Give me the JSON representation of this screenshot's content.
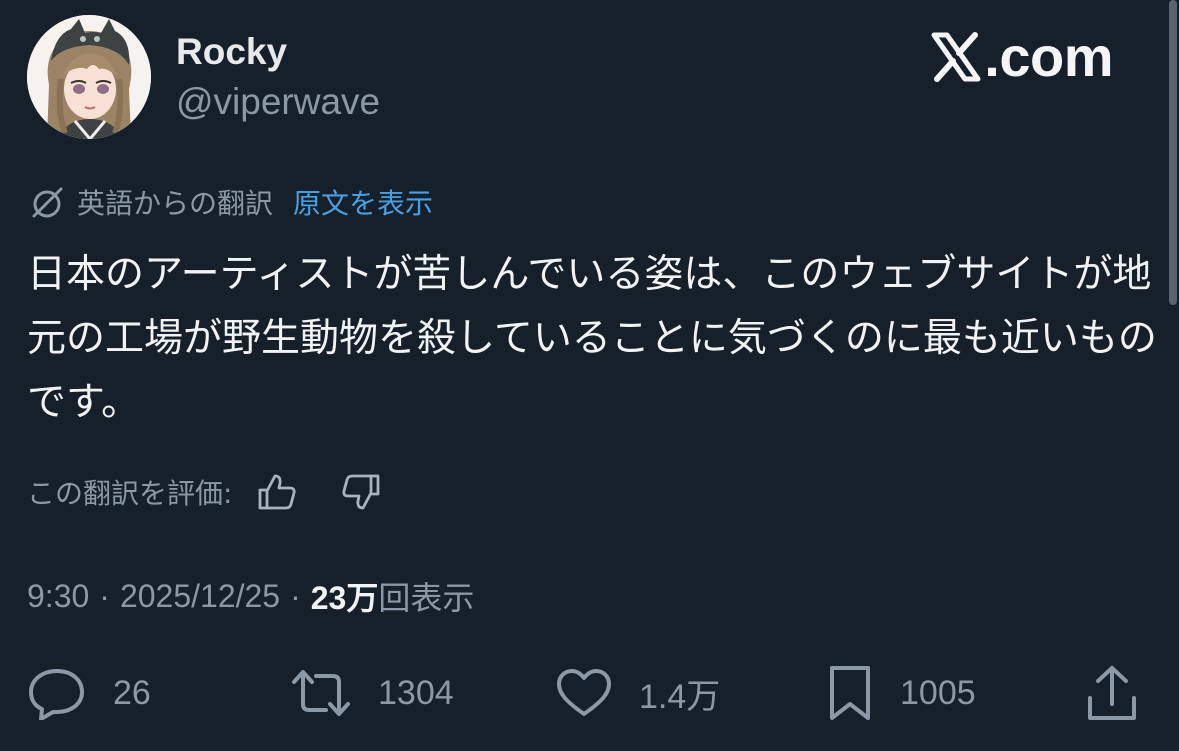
{
  "author": {
    "display_name": "Rocky",
    "handle": "@viperwave",
    "avatar_icon": "anime-girl-avatar"
  },
  "watermark": {
    "text": ".com",
    "logo_icon": "x-logo-icon"
  },
  "translation": {
    "label": "英語からの翻訳",
    "show_original": "原文を表示",
    "icon": "translate-icon"
  },
  "tweet": {
    "text": "日本のアーティストが苦しんでいる姿は、このウェブサイトが地元の工場が野生動物を殺していることに気づくのに最も近いものです。"
  },
  "rate": {
    "label": "この翻訳を評価:",
    "thumbs_up_icon": "thumbs-up-icon",
    "thumbs_down_icon": "thumbs-down-icon"
  },
  "meta": {
    "time": "9:30",
    "date": "2025/12/25",
    "separator": "·",
    "views_count": "23万",
    "views_label": "回表示"
  },
  "actions": {
    "replies": "26",
    "reposts": "1304",
    "likes": "1.4万",
    "bookmarks": "1005"
  },
  "colors": {
    "background": "#15202b",
    "primary_text": "#e7e9ea",
    "secondary_text": "#8b98a5",
    "link": "#4a9fe3"
  }
}
